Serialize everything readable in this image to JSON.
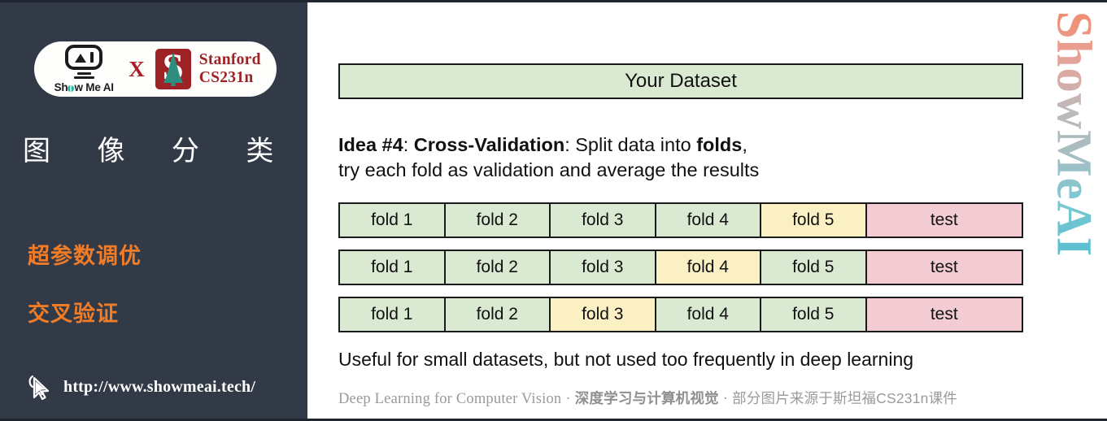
{
  "sidebar": {
    "brand": {
      "smai_name": "Show Me AI",
      "smai_pre": "Sh",
      "smai_post": "w Me AI",
      "x_label": "X",
      "seal_letter": "S",
      "stanford_line1": "Stanford",
      "stanford_line2": "CS231n"
    },
    "course_title": "图 像 分 类",
    "topics": [
      {
        "label": "超参数调优"
      },
      {
        "label": "交叉验证"
      }
    ],
    "site_url": "http://www.showmeai.tech/",
    "cursor_icon": "cursor-pointer-icon",
    "background_color": "#333a47",
    "accent_color": "#f07c28"
  },
  "main": {
    "dataset_bar_label": "Your Dataset",
    "idea": {
      "bold_label": "Idea #4",
      "sep1": ": ",
      "bold_method": "Cross-Validation",
      "mid": ": Split data into ",
      "bold_folds": "folds",
      "tail": ",",
      "line2": "try each fold as validation and average the results"
    },
    "note": "Useful for small datasets, but not used too frequently in deep learning",
    "footer": {
      "en": "Deep Learning for Computer Vision",
      "dot1": "·",
      "cn_bold": "深度学习与计算机视觉",
      "dot2": "·",
      "cn": "部分图片来源于斯坦福CS231n课件"
    },
    "watermark": "ShowMeAI",
    "colors": {
      "fold_green": "#dae9d2",
      "fold_selected_yellow": "#fbf0c4",
      "test_pink": "#f2ccd2",
      "border": "#1a1a1a"
    },
    "table": {
      "columns": [
        "fold 1",
        "fold 2",
        "fold 3",
        "fold 4",
        "fold 5",
        "test"
      ],
      "rows": [
        {
          "cells": [
            "fold 1",
            "fold 2",
            "fold 3",
            "fold 4",
            "fold 5",
            "test"
          ],
          "validation_index": 4
        },
        {
          "cells": [
            "fold 1",
            "fold 2",
            "fold 3",
            "fold 4",
            "fold 5",
            "test"
          ],
          "validation_index": 3
        },
        {
          "cells": [
            "fold 1",
            "fold 2",
            "fold 3",
            "fold 4",
            "fold 5",
            "test"
          ],
          "validation_index": 2
        }
      ]
    }
  }
}
